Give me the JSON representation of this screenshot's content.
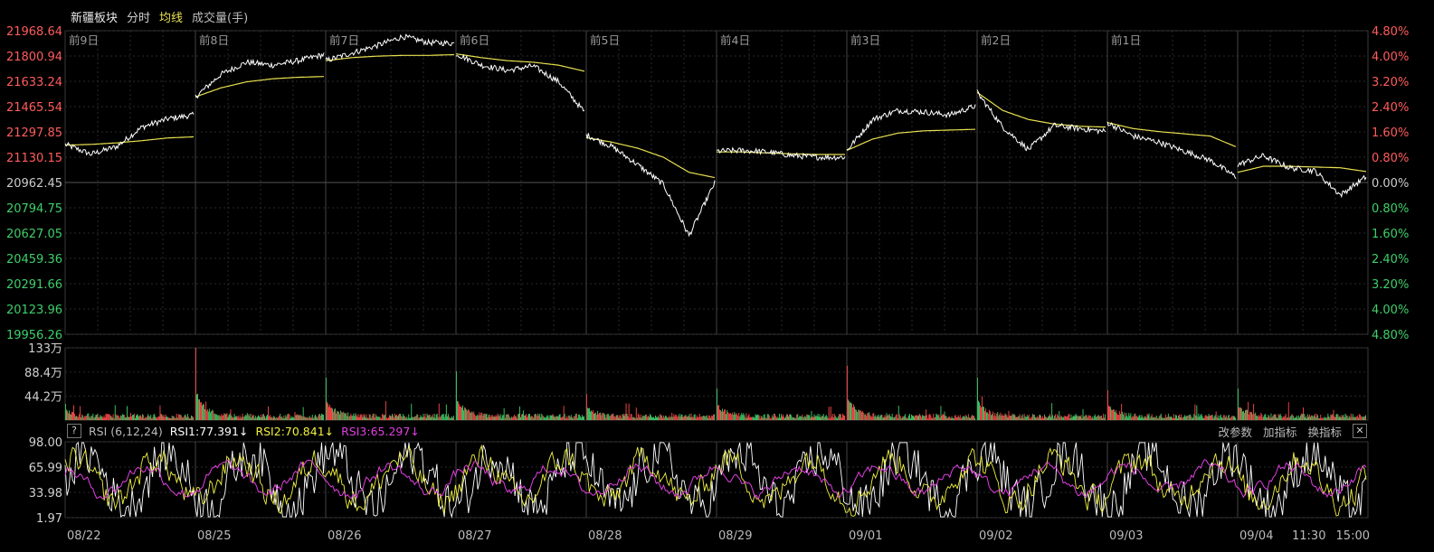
{
  "header": {
    "board_name": "新疆板块",
    "mode_label": "分时",
    "avg_label": "均线",
    "volume_label": "成交量(手)"
  },
  "colors": {
    "background": "#000000",
    "grid": "#2a2a2a",
    "grid_strong": "#3a3a3a",
    "price_line": "#ffffff",
    "avg_line": "#e8e050",
    "up": "#ff4a4a",
    "down": "#3ecf6a",
    "axis_text_up": "#ff5c5c",
    "axis_text_down": "#3ecf6a",
    "axis_text_flat": "#cccccc",
    "rsi1": "#ffffff",
    "rsi2": "#f0f040",
    "rsi3": "#e040e0"
  },
  "rsi_panel": {
    "help_label": "?",
    "name_label": "RSI (6,12,24)",
    "rsi1_label": "RSI1:77.391↓",
    "rsi2_label": "RSI2:70.841↓",
    "rsi3_label": "RSI3:65.297↓",
    "change_params": "改参数",
    "add_indicator": "加指标",
    "switch_indicator": "换指标",
    "close_label": "✕"
  },
  "chart_data": {
    "type": "line",
    "day_labels_top": [
      "前9日",
      "前8日",
      "前7日",
      "前6日",
      "前5日",
      "前4日",
      "前3日",
      "前2日",
      "前1日",
      ""
    ],
    "dates_bottom": [
      "08/22",
      "08/25",
      "08/26",
      "08/27",
      "08/28",
      "08/29",
      "09/01",
      "09/02",
      "09/03",
      "09/04"
    ],
    "extra_time_labels": [
      "11:30",
      "15:00"
    ],
    "price_axis": {
      "ticks": [
        "21968.64",
        "21800.94",
        "21633.24",
        "21465.54",
        "21297.85",
        "21130.15",
        "20962.45",
        "20794.75",
        "20627.05",
        "20459.36",
        "20291.66",
        "20123.96",
        "19956.26"
      ],
      "reference": 20962.45,
      "ylim": [
        19956.26,
        21968.64
      ]
    },
    "pct_axis": {
      "ticks": [
        "4.80%",
        "4.00%",
        "3.20%",
        "2.40%",
        "1.60%",
        "0.80%",
        "0.00%",
        "0.80%",
        "1.60%",
        "2.40%",
        "3.20%",
        "4.00%",
        "4.80%"
      ]
    },
    "volume_axis": {
      "ticks": [
        "133万",
        "88.4万",
        "44.2万"
      ],
      "ylim": [
        0,
        133
      ]
    },
    "rsi_axis": {
      "ticks": [
        "98.00",
        "65.99",
        "33.98",
        "1.97"
      ],
      "ylim": [
        1.97,
        98.0
      ]
    },
    "series": [
      {
        "key": "price",
        "days": [
          [
            21215,
            21150,
            21200,
            21330,
            21385,
            21410
          ],
          [
            21530,
            21680,
            21760,
            21740,
            21770,
            21810
          ],
          [
            21770,
            21820,
            21870,
            21930,
            21890,
            21885
          ],
          [
            21815,
            21740,
            21705,
            21735,
            21630,
            21430
          ],
          [
            21280,
            21200,
            21080,
            20950,
            20610,
            20960
          ],
          [
            21170,
            21175,
            21165,
            21140,
            21130,
            21130
          ],
          [
            21175,
            21380,
            21440,
            21430,
            21410,
            21470
          ],
          [
            21560,
            21330,
            21180,
            21340,
            21320,
            21300
          ],
          [
            21360,
            21270,
            21230,
            21170,
            21110,
            21000
          ],
          [
            21080,
            21140,
            21060,
            21040,
            20880,
            21000
          ]
        ]
      },
      {
        "key": "avg",
        "days": [
          [
            21210,
            21215,
            21225,
            21240,
            21258,
            21265
          ],
          [
            21530,
            21590,
            21630,
            21650,
            21660,
            21665
          ],
          [
            21770,
            21790,
            21800,
            21805,
            21805,
            21810
          ],
          [
            21815,
            21790,
            21770,
            21760,
            21740,
            21700
          ],
          [
            21260,
            21230,
            21190,
            21130,
            21030,
            20995
          ],
          [
            21165,
            21165,
            21158,
            21152,
            21148,
            21148
          ],
          [
            21175,
            21250,
            21290,
            21305,
            21310,
            21315
          ],
          [
            21560,
            21440,
            21380,
            21350,
            21335,
            21330
          ],
          [
            21360,
            21320,
            21300,
            21285,
            21270,
            21200
          ],
          [
            21030,
            21070,
            21070,
            21065,
            21060,
            21035
          ]
        ]
      },
      {
        "key": "volume_spikes",
        "values": [
          30,
          133,
          78,
          90,
          48,
          58,
          100,
          78,
          55,
          58
        ]
      }
    ]
  }
}
